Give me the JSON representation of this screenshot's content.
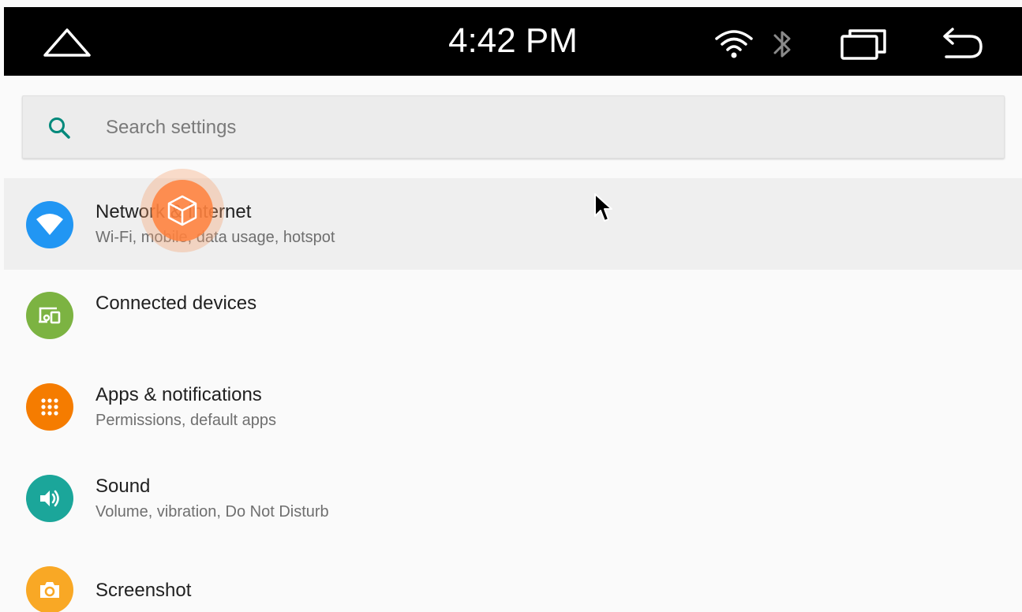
{
  "status_bar": {
    "time": "4:42 PM",
    "icons": [
      "home-icon",
      "wifi-icon",
      "bluetooth-icon",
      "recents-icon",
      "back-icon"
    ]
  },
  "search": {
    "placeholder": "Search settings",
    "value": ""
  },
  "settings": [
    {
      "title": "Network & internet",
      "subtitle": "Wi-Fi, mobile, data usage, hotspot",
      "icon": "wifi-icon",
      "color": "#2196f3"
    },
    {
      "title": "Connected devices",
      "subtitle": "",
      "icon": "devices-icon",
      "color": "#7cb342"
    },
    {
      "title": "Apps & notifications",
      "subtitle": "Permissions, default apps",
      "icon": "apps-grid-icon",
      "color": "#f57c00"
    },
    {
      "title": "Sound",
      "subtitle": "Volume, vibration, Do Not Disturb",
      "icon": "volume-icon",
      "color": "#1ba69a"
    },
    {
      "title": "Screenshot",
      "subtitle": "",
      "icon": "camera-icon",
      "color": "#f9a825"
    }
  ],
  "colors": {
    "status_bar_bg": "#000000",
    "accent": "#009688",
    "touch_indicator": "#ff803c"
  }
}
